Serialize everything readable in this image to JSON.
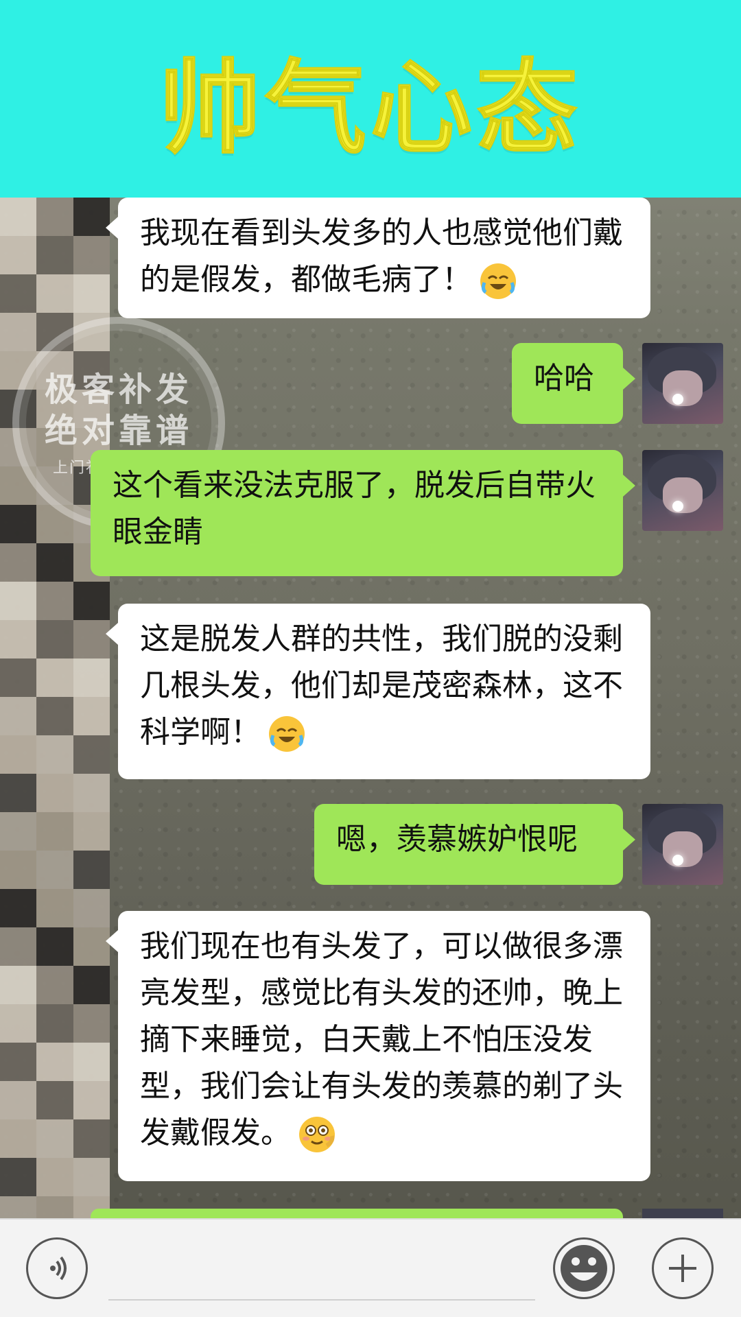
{
  "header": {
    "title": "帅气心态"
  },
  "watermark": {
    "line1": "极客补发",
    "line2": "绝对靠谱",
    "line3": "上门补发快乐到家"
  },
  "messages": [
    {
      "side": "in",
      "text": "我现在看到头发多的人也感觉他们戴的是假发，都做毛病了！",
      "emoji": "laughing-crying-emoji"
    },
    {
      "side": "out",
      "text": "哈哈"
    },
    {
      "side": "out",
      "text": "这个看来没法克服了，脱发后自带火眼金睛"
    },
    {
      "side": "in",
      "text": "这是脱发人群的共性，我们脱的没剩几根头发，他们却是茂密森林，这不科学啊！",
      "emoji": "laughing-crying-emoji"
    },
    {
      "side": "out",
      "text": "嗯，羡慕嫉妒恨呢"
    },
    {
      "side": "in",
      "text": "我们现在也有头发了，可以做很多漂亮发型，感觉比有头发的还帅，晚上摘下来睡觉，白天戴上不怕压没发型，我们会让有头发的羡慕的剃了头发戴假发。",
      "emoji": "flushed-smile-emoji"
    }
  ],
  "bottom_bar": {
    "voice_icon": "voice-icon",
    "emoji_icon": "smile-icon",
    "plus_icon": "plus-icon"
  },
  "colors": {
    "header_bg": "#2ff0e4",
    "title": "#f6f23a",
    "bubble_out": "#9fe658",
    "bubble_in": "#ffffff"
  }
}
